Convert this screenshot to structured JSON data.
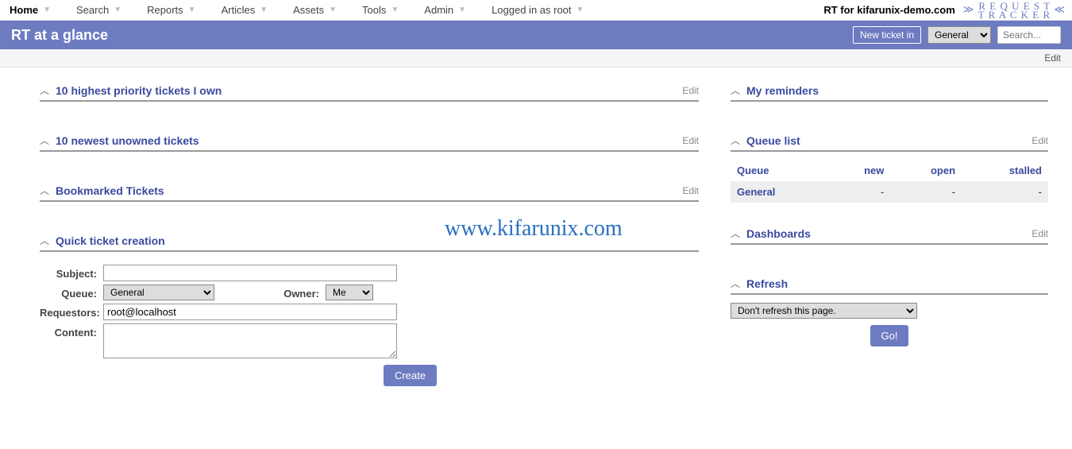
{
  "nav": {
    "items": [
      {
        "label": "Home",
        "home": true
      },
      {
        "label": "Search"
      },
      {
        "label": "Reports"
      },
      {
        "label": "Articles"
      },
      {
        "label": "Assets"
      },
      {
        "label": "Tools"
      },
      {
        "label": "Admin"
      },
      {
        "label": "Logged in as root"
      }
    ],
    "brand": "RT for kifarunix-demo.com",
    "logo_top": "R E Q U E S T",
    "logo_bottom": "T R A C K E R"
  },
  "titlebar": {
    "heading": "RT at a glance",
    "new_ticket_label": "New ticket in",
    "queue_value": "General",
    "search_placeholder": "Search..."
  },
  "editstrip": {
    "edit": "Edit"
  },
  "widgets": {
    "priority": {
      "title": "10 highest priority tickets I own",
      "edit": "Edit"
    },
    "unowned": {
      "title": "10 newest unowned tickets",
      "edit": "Edit"
    },
    "bookmarked": {
      "title": "Bookmarked Tickets",
      "edit": "Edit"
    },
    "quick": {
      "title": "Quick ticket creation",
      "labels": {
        "subject": "Subject:",
        "queue": "Queue:",
        "owner": "Owner:",
        "requestors": "Requestors:",
        "content": "Content:"
      },
      "queue_value": "General",
      "owner_value": "Me",
      "requestors_value": "root@localhost",
      "create": "Create"
    },
    "reminders": {
      "title": "My reminders"
    },
    "queuelist": {
      "title": "Queue list",
      "edit": "Edit",
      "cols": {
        "queue": "Queue",
        "new": "new",
        "open": "open",
        "stalled": "stalled"
      },
      "rows": [
        {
          "name": "General",
          "new": "-",
          "open": "-",
          "stalled": "-"
        }
      ]
    },
    "dashboards": {
      "title": "Dashboards",
      "edit": "Edit"
    },
    "refresh": {
      "title": "Refresh",
      "select_value": "Don't refresh this page.",
      "go": "Go!"
    }
  },
  "watermark": "www.kifarunix.com"
}
